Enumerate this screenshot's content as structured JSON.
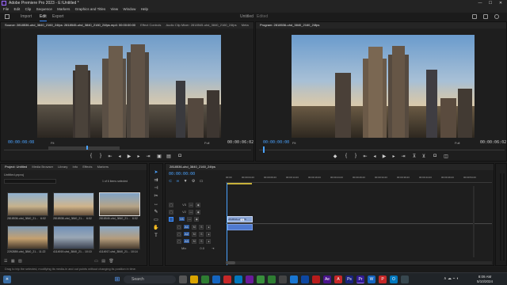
{
  "app": {
    "title": "Adobe Premiere Pro 2023 - E:\\Untitled *",
    "window_controls": [
      "—",
      "☐",
      "✕"
    ]
  },
  "menu": [
    "File",
    "Edit",
    "Clip",
    "Sequence",
    "Markers",
    "Graphics and Titles",
    "View",
    "Window",
    "Help"
  ],
  "workspace": {
    "tabs": [
      "Import",
      "Edit",
      "Export"
    ],
    "active": "Edit",
    "center_title": "Untitled",
    "center_sub": "Edited"
  },
  "source": {
    "tabs": [
      "Source: 2818536-uhd_3840_2160_24fps: 2818545-uhd_3840_2160_24fps.mp4: 00:00:00:00",
      "Effect Controls",
      "Audio Clip Mixer: 2818545-uhd_3840_2160_24fps",
      "Meta"
    ],
    "timecode_in": "00:00:08:08",
    "fit": "Fit",
    "full": "Full",
    "timecode_dur": "00:00:06:02"
  },
  "program": {
    "tabs": [
      "Program: 2818536-uhd_3840_2160_24fps"
    ],
    "timecode_in": "00:00:00:00",
    "fit": "Fit",
    "full": "Full",
    "timecode_dur": "00:00:06:02"
  },
  "project": {
    "tabs": [
      "Project: Untitled",
      "Media Browser",
      "Library",
      "Info",
      "Effects",
      "Markers"
    ],
    "file": "Untitled.prproj",
    "count": "1 of 6 items selected",
    "items": [
      {
        "label": "2818536-uhd_3840_21...",
        "dur": "6:02"
      },
      {
        "label": "2818538-uhd_3840_21...",
        "dur": "6:02"
      },
      {
        "label": "2818545-uhd_3840_21...",
        "dur": "6:02"
      },
      {
        "label": "2292859-uhd_3840_21...",
        "dur": "11:22"
      },
      {
        "label": "4114919-uhd_3840_21...",
        "dur": "10:10"
      },
      {
        "label": "4114917-uhd_3840_21...",
        "dur": "10:14"
      }
    ]
  },
  "timeline": {
    "tab": "2818536-uhd_3840_2160_24fps",
    "timecode": "00:00:00:00",
    "ruler": [
      "00:00",
      "00:00:04:23",
      "00:00:09:23",
      "00:00:14:23",
      "00:00:19:23",
      "00:00:24:23",
      "00:00:29:23",
      "00:00:34:23",
      "00:00:39:23",
      "00:00:44:23",
      "00:00:49:23",
      "00:00:54:23"
    ],
    "tracks": [
      "V3",
      "V2",
      "V1",
      "A1",
      "A2",
      "A3",
      "Mix"
    ],
    "clip_label": "2818536-uhd_38",
    "mix_value": "0.0"
  },
  "status_bar": "Drag to trip the selected, modifying its media-in and out points without changing its position in time.",
  "taskbar": {
    "search": "Search",
    "time": "8:09 AM",
    "date": "5/10/2024"
  },
  "colors": {
    "accent": "#3b8cff",
    "timecode": "#4aa3ff",
    "clip_audio": "#4f7ad0",
    "playhead": "#4aa3ff"
  }
}
